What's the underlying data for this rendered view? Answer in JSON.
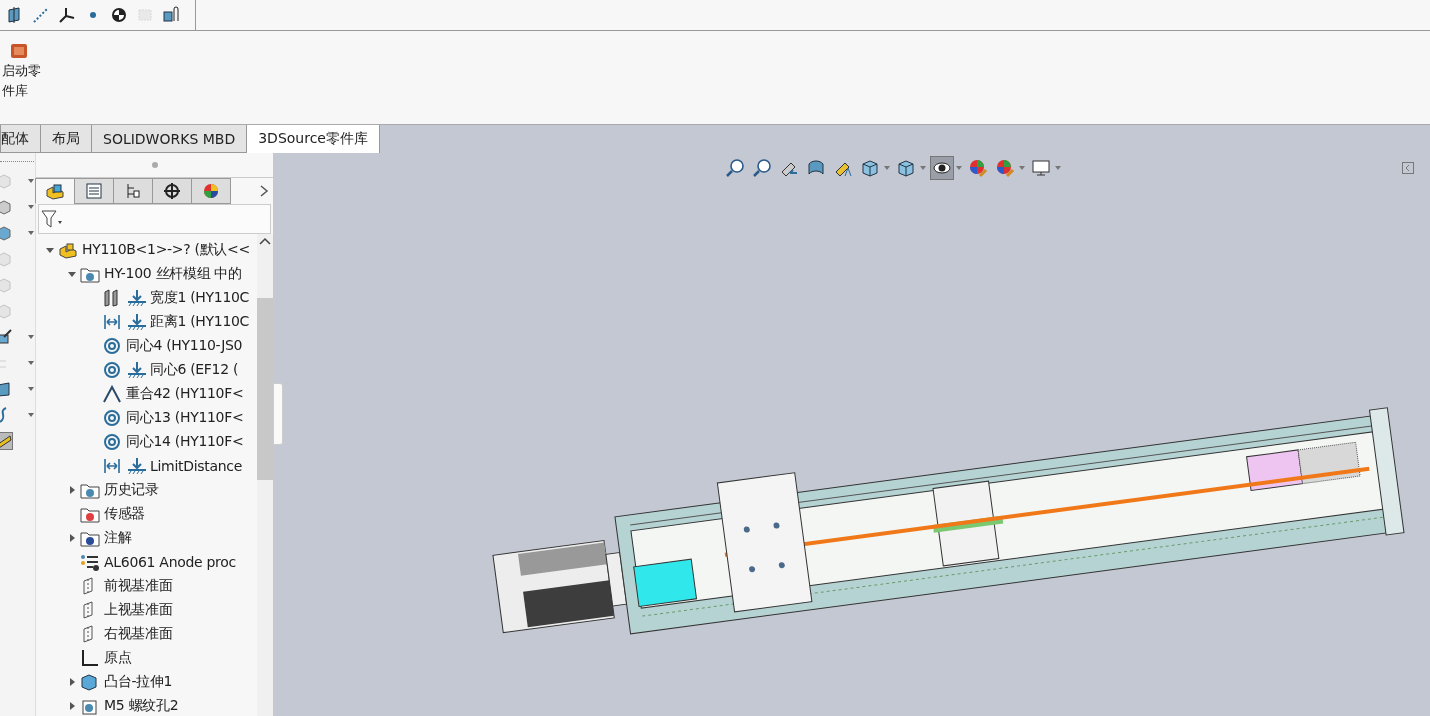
{
  "top_toolbar": [
    {
      "kind": "plane",
      "disabled": false
    },
    {
      "kind": "axis",
      "disabled": false
    },
    {
      "kind": "coordinate-system",
      "disabled": false
    },
    {
      "kind": "point",
      "disabled": false
    },
    {
      "kind": "center-of-mass",
      "disabled": false
    },
    {
      "kind": "bounding-box",
      "disabled": true
    },
    {
      "kind": "mate-reference",
      "disabled": false
    }
  ],
  "ribbon": {
    "launcher": {
      "lines": [
        "启动零",
        "件库"
      ]
    }
  },
  "tabs": [
    {
      "label": "配体",
      "selected": false
    },
    {
      "label": "布局",
      "selected": false
    },
    {
      "label": "SOLIDWORKS MBD",
      "selected": false
    },
    {
      "label": "3DSource零件库",
      "selected": true
    }
  ],
  "command_column": [
    {
      "kind": "cube",
      "disabled": true,
      "caret": true
    },
    {
      "kind": "shell",
      "disabled": false,
      "caret": true
    },
    {
      "kind": "box",
      "disabled": false,
      "caret": true
    },
    {
      "kind": "cube",
      "disabled": true,
      "caret": false
    },
    {
      "kind": "cube",
      "disabled": true,
      "caret": false
    },
    {
      "kind": "cube",
      "disabled": true,
      "caret": false
    },
    {
      "kind": "wand",
      "disabled": false,
      "caret": true
    },
    {
      "kind": "tree",
      "disabled": true,
      "caret": true
    },
    {
      "kind": "plane",
      "disabled": false,
      "caret": true
    },
    {
      "kind": "curve",
      "disabled": false,
      "caret": true
    },
    {
      "kind": "ruler",
      "disabled": false,
      "caret": false,
      "selected": true
    }
  ],
  "panel_tabs": [
    {
      "kind": "feature-manager",
      "selected": true
    },
    {
      "kind": "property-manager",
      "selected": false
    },
    {
      "kind": "configuration-manager",
      "selected": false
    },
    {
      "kind": "dimxpert",
      "selected": false
    },
    {
      "kind": "display-manager",
      "selected": false
    }
  ],
  "tree": [
    {
      "label": "HY110B<1>->? (默认<<",
      "kind": "assembly",
      "expanded": true,
      "children": [
        {
          "label": "HY-100 丝杆模组 中的",
          "kind": "mates-folder",
          "expanded": true,
          "children": [
            {
              "label": "宽度1 (HY110C",
              "kind": "width-mate",
              "anchored": true
            },
            {
              "label": "距离1 (HY110C",
              "kind": "distance-mate",
              "anchored": true
            },
            {
              "label": "同心4 (HY110-JS0",
              "kind": "concentric-mate",
              "anchored": false
            },
            {
              "label": "同心6 (EF12  (",
              "kind": "concentric-mate",
              "anchored": true
            },
            {
              "label": "重合42 (HY110F<",
              "kind": "coincident-mate",
              "anchored": false
            },
            {
              "label": "同心13 (HY110F<",
              "kind": "concentric-mate",
              "anchored": false
            },
            {
              "label": "同心14 (HY110F<",
              "kind": "concentric-mate",
              "anchored": false
            },
            {
              "label": "LimitDistance",
              "kind": "distance-mate",
              "anchored": true
            }
          ]
        },
        {
          "label": "历史记录",
          "kind": "history-folder",
          "expanded": false
        },
        {
          "label": "传感器",
          "kind": "sensor-folder"
        },
        {
          "label": "注解",
          "kind": "annotation-folder",
          "expanded": false
        },
        {
          "label": "AL6061 Anode proc",
          "kind": "material"
        },
        {
          "label": "前视基准面",
          "kind": "plane"
        },
        {
          "label": "上视基准面",
          "kind": "plane"
        },
        {
          "label": "右视基准面",
          "kind": "plane"
        },
        {
          "label": "原点",
          "kind": "origin"
        },
        {
          "label": "凸台-拉伸1",
          "kind": "extrude",
          "expanded": false
        },
        {
          "label": "M5 螺纹孔2",
          "kind": "hole",
          "expanded": false
        }
      ]
    }
  ],
  "view_toolbar": [
    {
      "kind": "zoom-fit",
      "selected": false,
      "caret": false
    },
    {
      "kind": "zoom-area",
      "selected": false,
      "caret": false
    },
    {
      "kind": "previous-view",
      "selected": false,
      "caret": false
    },
    {
      "kind": "section-view",
      "selected": false,
      "caret": false
    },
    {
      "kind": "dynamic-annotation",
      "selected": false,
      "caret": false
    },
    {
      "kind": "view-orientation",
      "selected": false,
      "caret": true
    },
    {
      "kind": "display-style",
      "selected": false,
      "caret": true
    },
    {
      "kind": "hide-show",
      "selected": true,
      "caret": true
    },
    {
      "kind": "edit-appearance",
      "selected": false,
      "caret": false
    },
    {
      "kind": "scene",
      "selected": false,
      "caret": true
    },
    {
      "kind": "view-settings",
      "selected": false,
      "caret": true
    }
  ]
}
